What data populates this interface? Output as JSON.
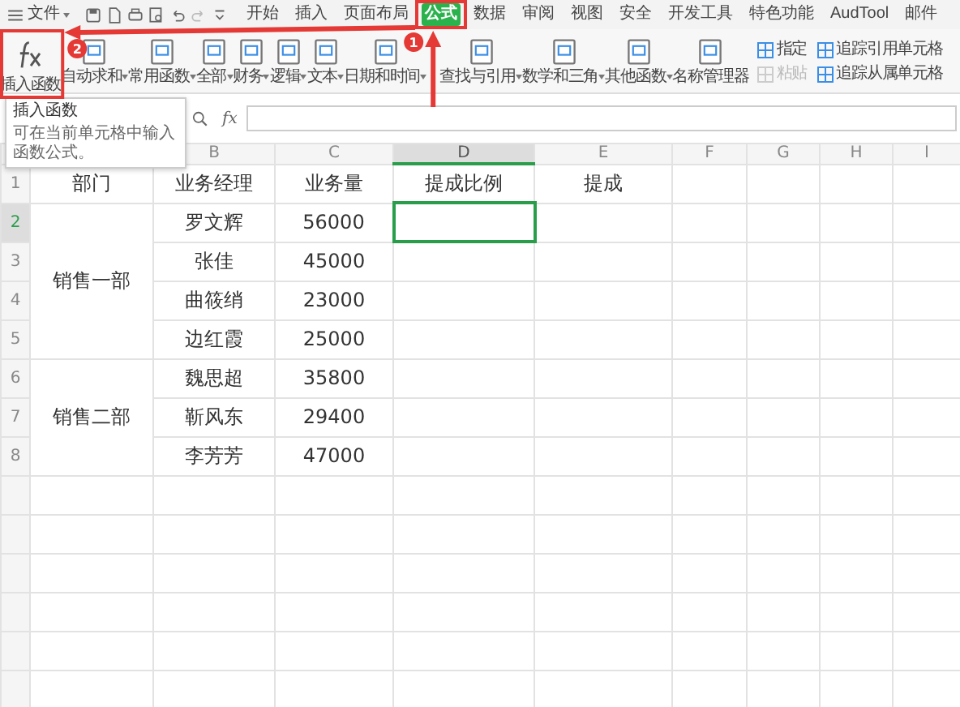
{
  "menu": {
    "label": "文件"
  },
  "tabs": [
    {
      "label": "开始",
      "selected": false
    },
    {
      "label": "插入",
      "selected": false
    },
    {
      "label": "页面布局",
      "selected": false
    },
    {
      "label": "公式",
      "selected": true
    },
    {
      "label": "数据",
      "selected": false
    },
    {
      "label": "审阅",
      "selected": false
    },
    {
      "label": "视图",
      "selected": false
    },
    {
      "label": "安全",
      "selected": false
    },
    {
      "label": "开发工具",
      "selected": false
    },
    {
      "label": "特色功能",
      "selected": false
    },
    {
      "label": "AudTool",
      "selected": false
    },
    {
      "label": "邮件",
      "selected": false
    }
  ],
  "ribbon": [
    {
      "kind": "large",
      "label": "插入函数",
      "dropdown": false
    },
    {
      "kind": "large",
      "label": "自动求和",
      "dropdown": true
    },
    {
      "kind": "large",
      "label": "常用函数",
      "dropdown": true
    },
    {
      "kind": "large",
      "label": "全部",
      "dropdown": true
    },
    {
      "kind": "large",
      "label": "财务",
      "dropdown": true
    },
    {
      "kind": "large",
      "label": "逻辑",
      "dropdown": true
    },
    {
      "kind": "large",
      "label": "文本",
      "dropdown": true
    },
    {
      "kind": "large",
      "label": "日期和时间",
      "dropdown": true
    },
    {
      "kind": "large",
      "label": "查找与引用",
      "dropdown": true
    },
    {
      "kind": "large",
      "label": "数学和三角",
      "dropdown": true
    },
    {
      "kind": "large",
      "label": "其他函数",
      "dropdown": true
    },
    {
      "kind": "large",
      "label": "名称管理器",
      "dropdown": false
    },
    {
      "kind": "stack",
      "items": [
        {
          "label": "指定",
          "disabled": false
        },
        {
          "label": "粘贴",
          "disabled": true
        }
      ]
    },
    {
      "kind": "stack",
      "items": [
        {
          "label": "追踪引用单元格",
          "disabled": false
        },
        {
          "label": "追踪从属单元格",
          "disabled": false
        }
      ]
    }
  ],
  "tooltip": {
    "title": "插入函数",
    "text": "可在当前单元格中输入函数公式。"
  },
  "formula_bar": {
    "fx": "fx"
  },
  "columns": [
    {
      "label": "B",
      "selected": false
    },
    {
      "label": "C",
      "selected": false
    },
    {
      "label": "D",
      "selected": true
    },
    {
      "label": "E",
      "selected": false
    },
    {
      "label": "F",
      "selected": false
    },
    {
      "label": "G",
      "selected": false
    },
    {
      "label": "H",
      "selected": false
    },
    {
      "label": "I",
      "selected": false
    }
  ],
  "header_row": {
    "number": "1",
    "cells": [
      "部门",
      "业务经理",
      "业务量",
      "提成比例",
      "提成"
    ]
  },
  "groups": [
    {
      "department": "销售一部",
      "rows": [
        {
          "number": "2",
          "manager": "罗文辉",
          "volume": "56000",
          "selected": true
        },
        {
          "number": "3",
          "manager": "张佳",
          "volume": "45000",
          "selected": false
        },
        {
          "number": "4",
          "manager": "曲筱绡",
          "volume": "23000",
          "selected": false
        },
        {
          "number": "5",
          "manager": "边红霞",
          "volume": "25000",
          "selected": false
        }
      ]
    },
    {
      "department": "销售二部",
      "rows": [
        {
          "number": "6",
          "manager": "魏思超",
          "volume": "35800",
          "selected": false
        },
        {
          "number": "7",
          "manager": "靳风东",
          "volume": "29400",
          "selected": false
        },
        {
          "number": "8",
          "manager": "李芳芳",
          "volume": "47000",
          "selected": false
        }
      ]
    }
  ],
  "annotations": [
    {
      "label": "1"
    },
    {
      "label": "2"
    }
  ]
}
